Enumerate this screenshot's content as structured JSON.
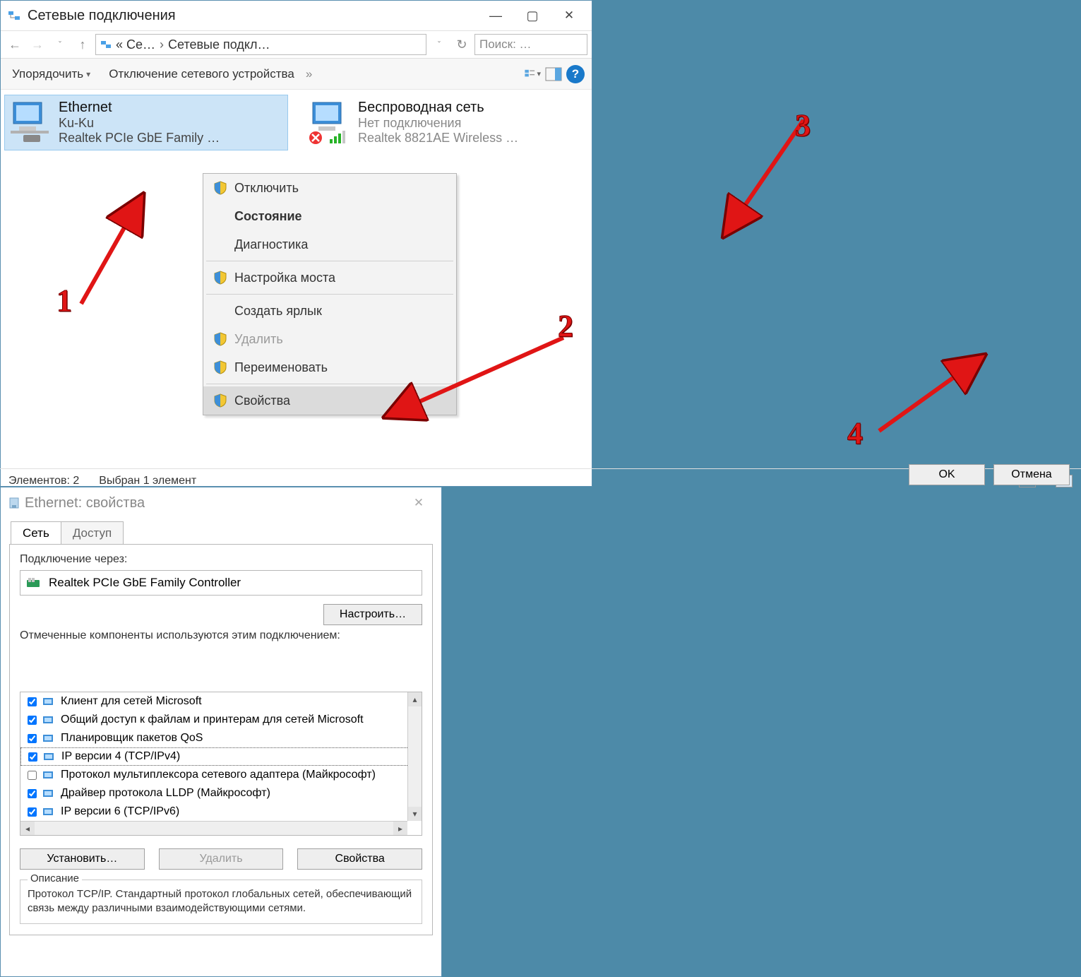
{
  "w1": {
    "title": "Сетевые подключения",
    "breadcrumb": {
      "a": "« Се…",
      "sep": "›",
      "b": "Сетевые подкл…"
    },
    "search_placeholder": "Поиск: …",
    "toolbar": {
      "organize": "Упорядочить",
      "disable": "Отключение сетевого устройства",
      "more": "»"
    },
    "adapters": {
      "ethernet": {
        "name": "Ethernet",
        "status": "Ku-Ku",
        "device": "Realtek PCIe GbE Family …"
      },
      "wifi": {
        "name": "Беспроводная сеть",
        "status": "Нет подключения",
        "device": "Realtek 8821AE Wireless …"
      }
    },
    "ctx": {
      "disable": "Отключить",
      "status": "Состояние",
      "diag": "Диагностика",
      "bridge": "Настройка моста",
      "shortcut": "Создать ярлык",
      "delete": "Удалить",
      "rename": "Переименовать",
      "properties": "Свойства"
    },
    "statusbar": {
      "count": "Элементов: 2",
      "selected": "Выбран 1 элемент"
    }
  },
  "w2": {
    "title": "Ethernet: свойства",
    "tab_net": "Сеть",
    "tab_access": "Доступ",
    "connect_label": "Подключение через:",
    "adapter": "Realtek PCIe GbE Family Controller",
    "configure_btn": "Настроить…",
    "components_label": "Отмеченные компоненты используются этим подключением:",
    "components": [
      {
        "checked": true,
        "text": "Клиент для сетей Microsoft"
      },
      {
        "checked": true,
        "text": "Общий доступ к файлам и принтерам для сетей Microsoft"
      },
      {
        "checked": true,
        "text": "Планировщик пакетов QoS"
      },
      {
        "checked": true,
        "text": "IP версии 4 (TCP/IPv4)",
        "selected": true
      },
      {
        "checked": false,
        "text": "Протокол мультиплексора сетевого адаптера (Майкрософт)"
      },
      {
        "checked": true,
        "text": "Драйвер протокола LLDP (Майкрософт)"
      },
      {
        "checked": true,
        "text": "IP версии 6 (TCP/IPv6)"
      }
    ],
    "install_btn": "Установить…",
    "remove_btn": "Удалить",
    "properties_btn": "Свойства",
    "desc_legend": "Описание",
    "desc_text": "Протокол TCP/IP. Стандартный протокол глобальных сетей, обеспечивающий связь между различными взаимодействующими сетями.",
    "ok_btn": "OK",
    "cancel_btn": "Отмена"
  },
  "callouts": {
    "c1": "1",
    "c2": "2",
    "c3": "3",
    "c4": "4"
  }
}
